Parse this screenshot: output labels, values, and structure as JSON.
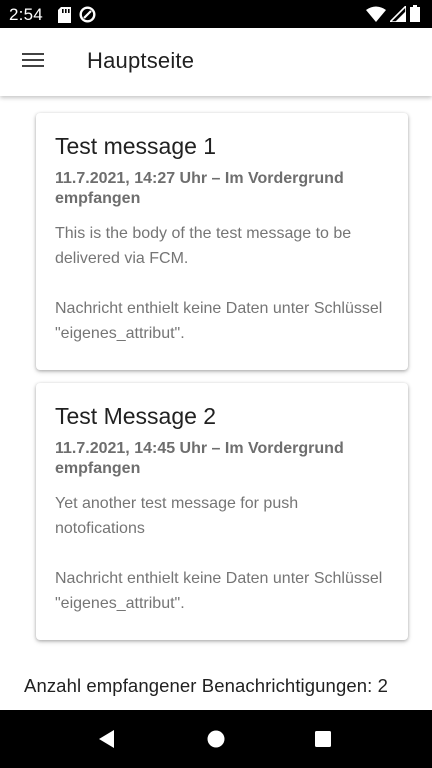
{
  "status_bar": {
    "time": "2:54",
    "left_icons": [
      "sd-card-icon",
      "data-saver-icon"
    ],
    "right_icons": [
      "wifi-icon",
      "signal-icon",
      "battery-icon"
    ]
  },
  "app_bar": {
    "title": "Hauptseite",
    "menu_icon": "menu-icon"
  },
  "messages": [
    {
      "title": "Test message 1",
      "meta": "11.7.2021, 14:27 Uhr – Im Vordergrund empfangen",
      "body": "This is the body of the test message to be delivered via FCM.",
      "note": "Nachricht enthielt keine Daten unter Schlüssel \"eigenes_attribut\"."
    },
    {
      "title": "Test Message 2",
      "meta": "11.7.2021, 14:45 Uhr – Im Vordergrund empfangen",
      "body": "Yet another test message for push notofications",
      "note": "Nachricht enthielt keine Daten unter Schlüssel \"eigenes_attribut\"."
    }
  ],
  "footer": {
    "count_text": "Anzahl empfangener Benachrichtigungen: 2"
  },
  "nav_bar": {
    "buttons": [
      "back-icon",
      "home-icon",
      "recents-icon"
    ]
  },
  "colors": {
    "status_bar_bg": "#000000",
    "app_bar_bg": "#ffffff",
    "title_text": "#212121",
    "secondary_text": "#757575"
  }
}
